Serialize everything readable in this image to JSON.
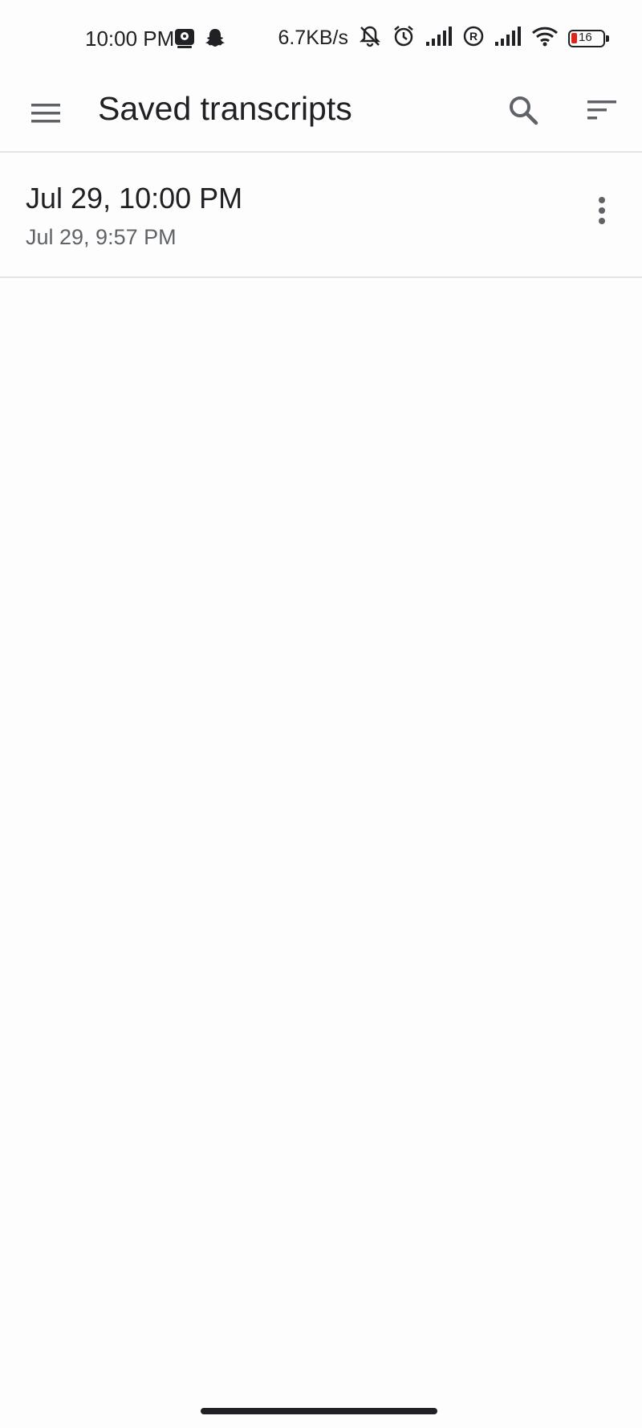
{
  "status_bar": {
    "time": "10:00 PM",
    "network_speed": "6.7KB/s",
    "battery_level": "16",
    "icons": [
      "app-notification-icon",
      "snapchat-icon",
      "silent-bell-icon",
      "alarm-icon",
      "signal-icon",
      "roaming-icon",
      "signal-icon",
      "wifi-icon",
      "battery-icon"
    ],
    "battery_low_color": "#e2231a"
  },
  "app_bar": {
    "title": "Saved transcripts",
    "icons": [
      "menu-icon",
      "search-icon",
      "sort-icon"
    ]
  },
  "transcripts": [
    {
      "title": "Jul 29, 10:00 PM",
      "subtitle": "Jul 29, 9:57 PM"
    }
  ],
  "colors": {
    "text_primary": "#202124",
    "text_secondary": "#5f6368",
    "divider": "#e3e3e3",
    "background": "#fdfdfd"
  }
}
